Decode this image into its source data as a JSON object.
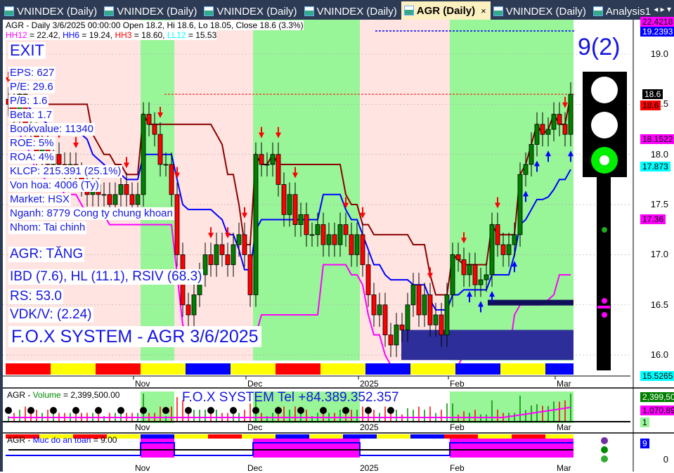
{
  "tabs": [
    {
      "label": "VNINDEX (Daily)"
    },
    {
      "label": "VNINDEX (Daily)"
    },
    {
      "label": "VNINDEX (Daily)"
    },
    {
      "label": "VNINDEX (Daily)"
    },
    {
      "label": "AGR (Daily)",
      "active": true
    },
    {
      "label": "VNINDEX (Daily)"
    },
    {
      "label": "Analysis1"
    }
  ],
  "tab_close": "×",
  "tab_nav": "◂ ▸ ▾",
  "header": {
    "line1": "AGR - Daily 3/6/2025 00:00:00 Open 18.2, Hi 18.6, Lo 18.05, Close 18.6 (3.3%)",
    "hh12_label": "HH12",
    "hh12": " = 22.42, ",
    "hh6_label": "HH6",
    "hh6": " = 19.24, ",
    "hh3_label": "HH3",
    "hh3": " = 18.60, ",
    "ll12_label": "LL12",
    "ll12": " = 15.53"
  },
  "signal": "EXIT",
  "fundamentals": [
    "EPS: 627",
    "P/E: 29.6",
    "P/B: 1.6",
    "Beta: 1.7",
    "Bookvalue: 11340",
    "ROE: 5%",
    "ROA: 4%",
    "KLCP: 215.391 (25.1%)",
    "Von hoa: 4006 (Ty)",
    "Market: HSX",
    "Nganh: 8779 Cong ty chung khoan",
    "Nhom: Tai chinh"
  ],
  "status": {
    "trend": "AGR: TĂNG",
    "ratings": "IBD (7.6), HL (11.1), RSIV (68.3)",
    "rs": "RS: 53.0",
    "vdk": "VDK/V:  (2.24)",
    "title": "F.O.X SYSTEM - AGR 3/6/2025"
  },
  "score": "9(2)",
  "price_axis": {
    "ticks": [
      "19.0",
      "18.5",
      "18.0",
      "17.5",
      "17.0",
      "16.5",
      "16.0"
    ],
    "labels": [
      {
        "text": "22.4218",
        "bg": "#ff00ff",
        "fg": "#000"
      },
      {
        "text": "19.2393",
        "bg": "#0000ff",
        "fg": "#fff"
      },
      {
        "text": "18.6",
        "bg": "#000",
        "fg": "#fff"
      },
      {
        "text": "18.6",
        "bg": "#ff0000",
        "fg": "#000"
      },
      {
        "text": "18.1522",
        "bg": "#ff00ff",
        "fg": "#000"
      },
      {
        "text": "17.873",
        "bg": "#00ffff",
        "fg": "#000"
      },
      {
        "text": "17.36",
        "bg": "#ff00ff",
        "fg": "#000"
      },
      {
        "text": "15.5265",
        "bg": "#00ffff",
        "fg": "#000"
      }
    ]
  },
  "date_labels": [
    "Nov",
    "Dec",
    "2025",
    "Feb",
    "Mar"
  ],
  "volume_panel": {
    "title_sym": "AGR - ",
    "title_name": "Volume",
    "title_val": " = 2,399,500.00",
    "banner": "F.O.X SYSTEM Tel +84.389.352.357",
    "labels": [
      {
        "text": "2,399,500",
        "bg": "#008000",
        "fg": "#fff"
      },
      {
        "text": "1,070,895",
        "bg": "#ff00ff",
        "fg": "#000"
      },
      {
        "text": "1",
        "bg": "#98f598",
        "fg": "#000"
      }
    ]
  },
  "safety_panel": {
    "title_sym": "AGR - ",
    "title_name": "Muc do an toan",
    "title_val": " = 9.00",
    "value_label": "9",
    "zero_tick": "0"
  },
  "chart_data": {
    "type": "candlestick",
    "ylim": [
      15.8,
      19.2
    ],
    "closes": [
      18.5,
      18.4,
      18.6,
      18.3,
      18.2,
      18.0,
      18.1,
      17.9,
      18.0,
      17.9,
      17.8,
      17.9,
      17.8,
      17.7,
      17.6,
      17.7,
      17.6,
      17.6,
      17.5,
      17.6,
      17.7,
      17.6,
      17.5,
      17.6,
      18.4,
      18.3,
      18.2,
      17.9,
      17.9,
      17.6,
      17.0,
      16.5,
      16.4,
      16.6,
      16.8,
      17.0,
      16.9,
      17.1,
      17.0,
      16.9,
      17.1,
      17.2,
      17.0,
      16.6,
      18.0,
      17.9,
      17.9,
      18.0,
      17.7,
      17.4,
      17.6,
      17.3,
      17.4,
      17.2,
      17.2,
      17.3,
      17.1,
      17.2,
      17.1,
      17.3,
      17.2,
      17.0,
      17.2,
      16.9,
      16.6,
      16.4,
      16.5,
      16.2,
      16.1,
      16.3,
      16.25,
      16.5,
      16.7,
      16.4,
      16.6,
      16.3,
      16.4,
      16.2,
      16.6,
      17.0,
      16.95,
      16.8,
      16.9,
      16.7,
      16.75,
      16.8,
      17.3,
      17.1,
      17.0,
      17.1,
      17.2,
      17.8,
      17.9,
      18.1,
      18.3,
      18.2,
      18.25,
      18.4,
      18.3,
      18.2,
      18.6
    ],
    "bands": [
      {
        "from": 0,
        "to": 23,
        "state": "down"
      },
      {
        "from": 24,
        "to": 29,
        "state": "up"
      },
      {
        "from": 30,
        "to": 43,
        "state": "down"
      },
      {
        "from": 44,
        "to": 62,
        "state": "up"
      },
      {
        "from": 63,
        "to": 78,
        "state": "down"
      },
      {
        "from": 79,
        "to": 100,
        "state": "up"
      }
    ],
    "date_index": [
      23,
      43,
      63,
      79,
      98
    ]
  },
  "colors": {
    "up": "#008000",
    "down": "#ff0000",
    "band_up": "#98f598",
    "band_down": "#ffe4e1",
    "accent": "#1515e0"
  }
}
